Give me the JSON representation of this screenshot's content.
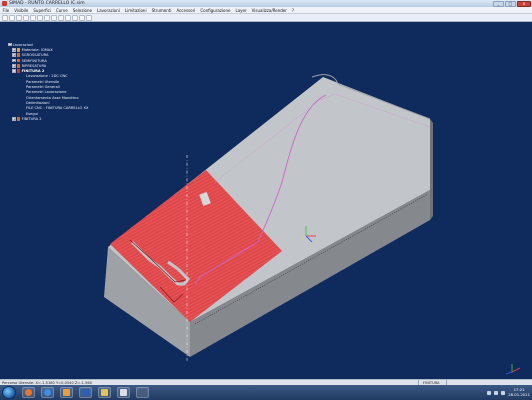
{
  "window": {
    "title": "SIMAD - RUNTO CARRELLO IC.sim",
    "controls": {
      "minimize": "_",
      "maximize": "□",
      "close": "x"
    }
  },
  "menu": [
    "File",
    "Visibile",
    "Superfici",
    "Curve",
    "Selezione",
    "Lavorazioni",
    "Limitazioni",
    "Strumenti",
    "Accessori",
    "Configurazione",
    "Layer",
    "Visualizza/Render",
    "?"
  ],
  "toolbar": {
    "buttons": [
      "new",
      "open",
      "save",
      "print",
      "undo",
      "redo",
      "zoom",
      "rotate",
      "pan",
      "fit",
      "wireframe",
      "shaded",
      "settings"
    ]
  },
  "tree": {
    "root": "Lavorazioni",
    "items": [
      {
        "label": "Materiale: IOMAX",
        "level": 1,
        "expander": "+",
        "color": "#d9a43a"
      },
      {
        "label": "SGROSSATURA",
        "level": 1,
        "expander": "+",
        "color": "#d96a2a"
      },
      {
        "label": "SEMIFINITURA",
        "level": 1,
        "expander": "+",
        "color": "#d96a2a"
      },
      {
        "label": "RIPRESATURA",
        "level": 1,
        "expander": "+",
        "color": "#d96a2a"
      },
      {
        "label": "FINITURA 2",
        "level": 1,
        "expander": "-",
        "color": "#cf3a2a",
        "selected": true
      },
      {
        "label": "Lavorazione : 2DC CNC",
        "level": 2
      },
      {
        "label": "Parametri Utensile",
        "level": 2
      },
      {
        "label": "Parametri Generali",
        "level": 2
      },
      {
        "label": "Parametri Lavorazione",
        "level": 2
      },
      {
        "label": "Orientamento Asse Mandrino",
        "level": 2
      },
      {
        "label": "Delimitazioni",
        "level": 2
      },
      {
        "label": "FILE CNC : FINITURA CARRELLO XX",
        "level": 2
      },
      {
        "label": "Esegui",
        "level": 2
      },
      {
        "label": "FINITURA 2",
        "level": 1,
        "expander": "+",
        "color": "#d96a2a"
      }
    ]
  },
  "status": {
    "left": "Percorso Utensile: X=-1.5180 Y=0.0540 Z=-1.560",
    "middle": "FINITURA"
  },
  "taskbar": {
    "apps": [
      "firefox",
      "explorer",
      "media",
      "word",
      "folder",
      "simad",
      "cad"
    ],
    "clock_time": "17:21",
    "clock_date": "28.01.2011"
  },
  "colors": {
    "viewport_bg": "#0f2a5c",
    "solid_top": "#c2c5c9",
    "solid_front": "#9ea1a5",
    "solid_side": "#85888c",
    "finished_surface": "#e0474a",
    "toolpath": "#cc66cc",
    "axis": "#f2f2f2"
  }
}
